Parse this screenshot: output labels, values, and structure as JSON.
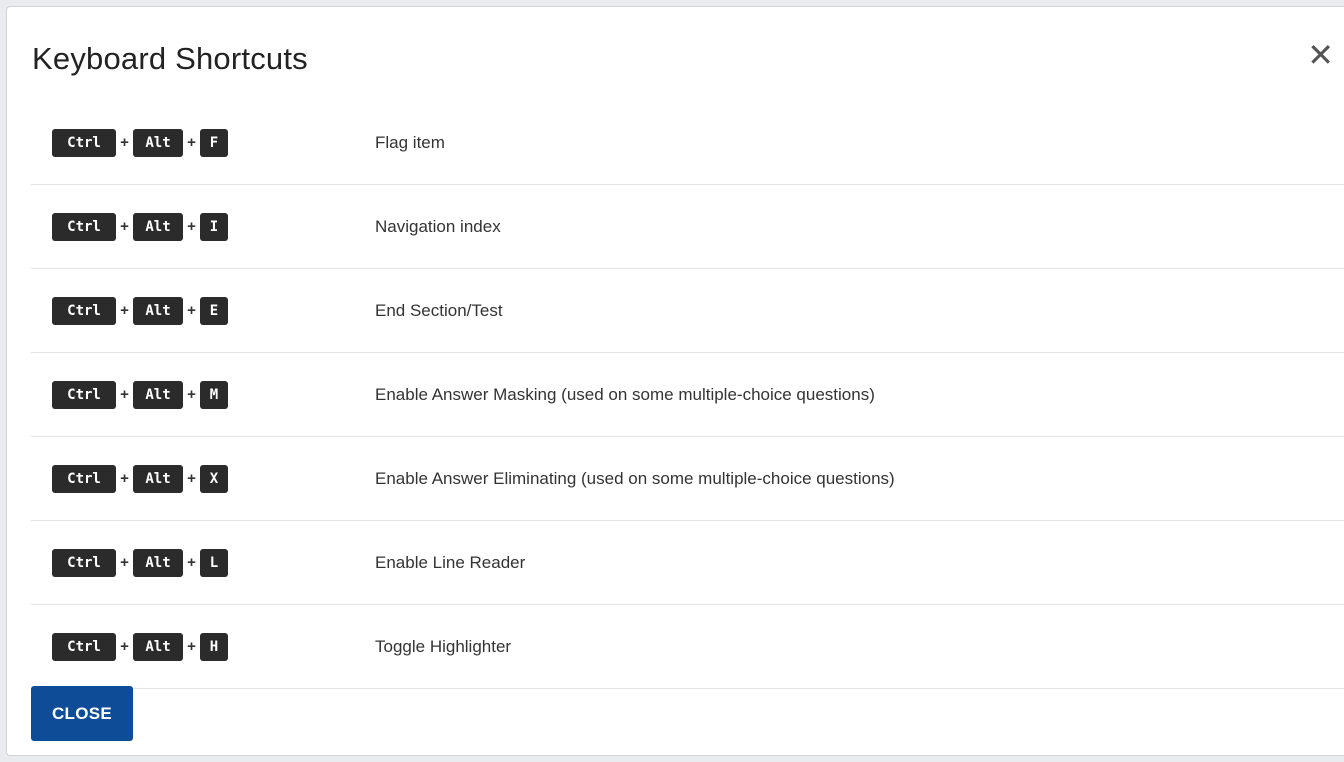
{
  "dialog": {
    "title": "Keyboard Shortcuts",
    "close_icon": "close-icon",
    "close_glyph": "✕",
    "close_button_label": "CLOSE"
  },
  "key_labels": {
    "ctrl": "Ctrl",
    "alt": "Alt",
    "plus": "+"
  },
  "shortcuts": [
    {
      "key": "F",
      "description": "Flag item"
    },
    {
      "key": "I",
      "description": "Navigation index"
    },
    {
      "key": "E",
      "description": "End Section/Test"
    },
    {
      "key": "M",
      "description": "Enable Answer Masking (used on some multiple-choice questions)"
    },
    {
      "key": "X",
      "description": "Enable Answer Eliminating (used on some multiple-choice questions)"
    },
    {
      "key": "L",
      "description": "Enable Line Reader"
    },
    {
      "key": "H",
      "description": "Toggle Highlighter"
    }
  ],
  "colors": {
    "key_background": "#2b2b2b",
    "button_background": "#0f4c97"
  }
}
